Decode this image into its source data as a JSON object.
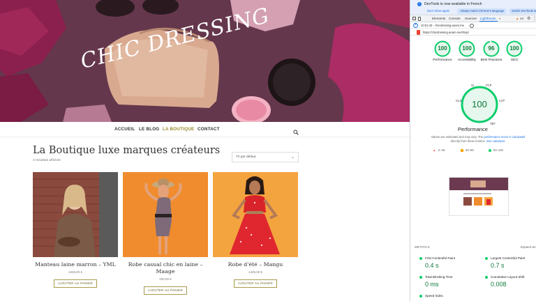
{
  "site": {
    "hero_title": "CHIC DRESSING",
    "nav": [
      {
        "label": "ACCUEIL"
      },
      {
        "label": "LE BLOG"
      },
      {
        "label": "LA BOUTIQUE"
      },
      {
        "label": "CONTACT"
      }
    ],
    "shop_title": "La Boutique luxe marques créateurs",
    "results_count": "3 résultats affichés",
    "sort_value": "Tri par défaut",
    "products": [
      {
        "name": "Manteau laine marron – YML",
        "price": "1325,00 €",
        "button": "AJOUTER AU PANIER"
      },
      {
        "name": "Robe casual chic en laine – Maage",
        "price": "220,00 €",
        "button": "AJOUTER AU PANIER"
      },
      {
        "name": "Robe d'été – Mangu",
        "price": "1325,00 €",
        "button": "AJOUTER AU PANIER"
      }
    ]
  },
  "devtools": {
    "notice": "DevTools is now available in French",
    "notice_buttons": [
      "Don't show again",
      "Always match Chrome's language",
      "Switch DevTools to"
    ],
    "tabs": [
      "Elements",
      "Console",
      "Sources",
      "Lighthouse"
    ],
    "active_tab": "Lighthouse",
    "more_tabs": "»",
    "issues_count": "14",
    "report_time": "10:51:40 - chicdressing.anam.me",
    "url": "https://chicdressing.anam.me/shop/",
    "categories": [
      {
        "label": "Performance",
        "score": 100
      },
      {
        "label": "Accessibility",
        "score": 100
      },
      {
        "label": "Best Practices",
        "score": 96
      },
      {
        "label": "SEO",
        "score": 100
      }
    ],
    "performance": {
      "score": 100,
      "title": "Performance",
      "segments": [
        "SI",
        "FCP",
        "LCP",
        "TBT",
        "CLS"
      ],
      "note_1": "Values are estimated and may vary. The",
      "note_link_1": "performance score is calculated",
      "note_2": "directly from these metrics.",
      "note_link_2": "See calculator."
    },
    "legend": [
      "0–49",
      "50–89",
      "90–100"
    ],
    "metrics_header": "METRICS",
    "expand_view": "Expand vie",
    "metrics": [
      {
        "label": "First Contentful Paint",
        "value": "0.4 s"
      },
      {
        "label": "Largest Contentful Paint",
        "value": "0.7 s"
      },
      {
        "label": "Total Blocking Time",
        "value": "0 ms"
      },
      {
        "label": "Cumulative Layout Shift",
        "value": "0.008"
      },
      {
        "label": "Speed Index",
        "value": ""
      }
    ],
    "colors": {
      "pass": "#0cce6b",
      "average": "#ffa400",
      "fail": "#ff4e42",
      "link": "#1a73e8"
    }
  }
}
